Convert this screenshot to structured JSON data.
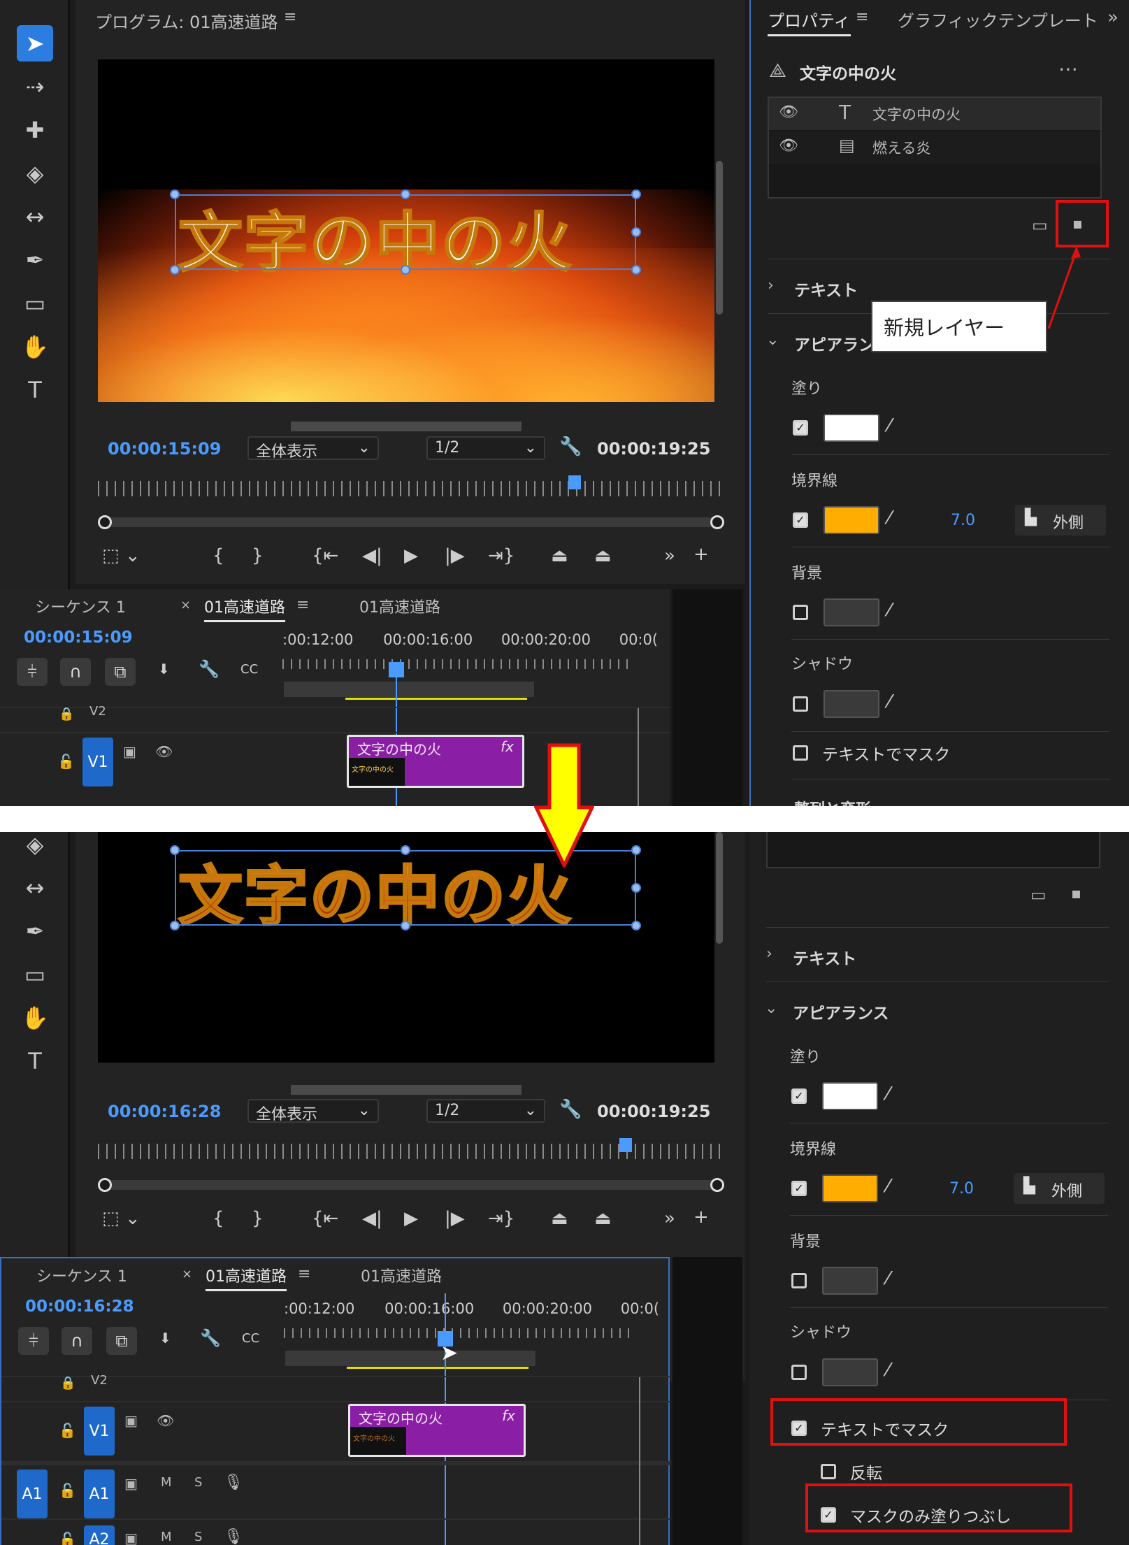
{
  "colors": {
    "accent": "#4b9bff",
    "clip": "#8a1fa6",
    "highlight": "#e01010",
    "fill_white": "#ffffff",
    "stroke_orange": "#ffae00",
    "arrow_yellow": "#ffff00"
  },
  "program": {
    "title": "プログラム: 01高速道路",
    "video_text": "文字の中の火",
    "zoom": "全体表示",
    "resolution": "1/2",
    "duration": "00:00:19:25"
  },
  "top": {
    "timecode": "00:00:15:09",
    "timeline_timecode": "00:00:15:09"
  },
  "bottom": {
    "timecode": "00:00:16:28",
    "timeline_timecode": "00:00:16:28"
  },
  "timeline": {
    "tabs": [
      "シーケンス 1",
      "01高速道路",
      "01高速道路"
    ],
    "ruler_labels": [
      ":00:12:00",
      "00:00:16:00",
      "00:00:20:00",
      "00:0("
    ],
    "tracks": {
      "v2": "V2",
      "v1": "V1",
      "a1": "A1",
      "a2": "A2",
      "m": "M",
      "s": "S"
    },
    "clip_name": "文字の中の火",
    "clip_fx": "fx",
    "clip_thumb": "文字の中の火"
  },
  "panel": {
    "tab_properties": "プロパティ",
    "tab_graphic": "グラフィックテンプレート",
    "title": "文字の中の火",
    "layers": [
      {
        "name": "文字の中の火",
        "icon": "T"
      },
      {
        "name": "燃える炎",
        "icon": "▤"
      }
    ],
    "section_text": "テキスト",
    "section_appearance": "アピアランス",
    "fill": "塗り",
    "stroke": "境界線",
    "stroke_value": "7.0",
    "stroke_pos": "外側",
    "background": "背景",
    "shadow": "シャドウ",
    "mask": "テキストでマスク",
    "invert": "反転",
    "fill_only": "マスクのみ塗りつぶし",
    "align": "整列と変形"
  },
  "annotation": {
    "new_layer": "新規レイヤー"
  }
}
